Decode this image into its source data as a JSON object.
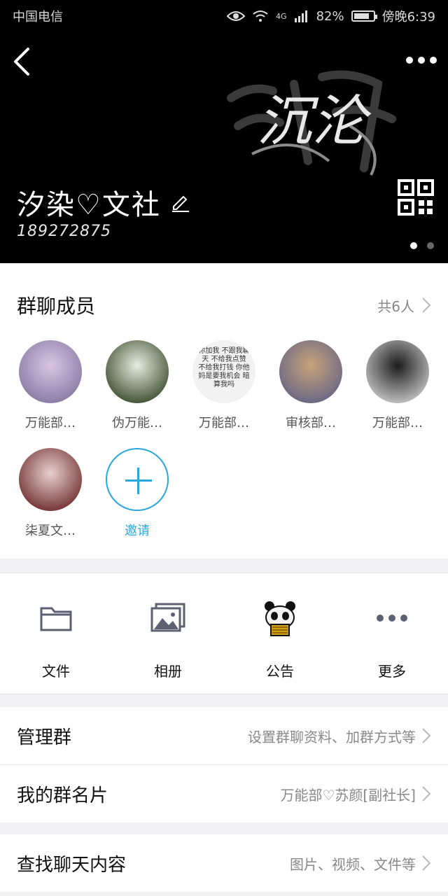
{
  "status_bar": {
    "carrier": "中国电信",
    "network": "4G",
    "battery": "82%",
    "battery_level": 0.82,
    "time": "傍晚6:39"
  },
  "header": {
    "group_name": "汐染♡文社",
    "group_id": "189272875",
    "banner_text": "沉沦",
    "page_count": 2,
    "active_page": 1
  },
  "members_section": {
    "title": "群聊成员",
    "count": "共6人",
    "members": [
      {
        "name": "万能部…",
        "colors": [
          "#8d7fa6",
          "#d9c6e6"
        ]
      },
      {
        "name": "伪万能…",
        "colors": [
          "#4a5a3c",
          "#e6ede0"
        ]
      },
      {
        "name": "万能部…",
        "colors": [
          "#f2f2f2",
          "#333333"
        ],
        "avatar_text": "你加我 不跟我聊天 不给我点赞 不给我打钱 你他妈是要我机会 暗算我吗"
      },
      {
        "name": "审核部…",
        "colors": [
          "#6e6a84",
          "#c9a37a"
        ]
      },
      {
        "name": "万能部…",
        "colors": [
          "#b9b9b9",
          "#1c1c1c"
        ]
      },
      {
        "name": "柒夏文…",
        "colors": [
          "#7a3b3b",
          "#e7d2cf"
        ]
      }
    ],
    "invite_label": "邀请"
  },
  "actions": [
    {
      "label": "文件",
      "icon": "folder-icon"
    },
    {
      "label": "相册",
      "icon": "album-icon"
    },
    {
      "label": "公告",
      "icon": "panda-icon"
    },
    {
      "label": "更多",
      "icon": "more-dots-icon"
    }
  ],
  "rows": {
    "manage": {
      "title": "管理群",
      "value": "设置群聊资料、加群方式等"
    },
    "card": {
      "title": "我的群名片",
      "value": "万能部♡苏颜[副社长]"
    },
    "search": {
      "title": "查找聊天内容",
      "value": "图片、视频、文件等"
    }
  },
  "colors": {
    "accent": "#2aa7e0",
    "header_bg": "#000000",
    "page_bg": "#f2f2f4"
  }
}
